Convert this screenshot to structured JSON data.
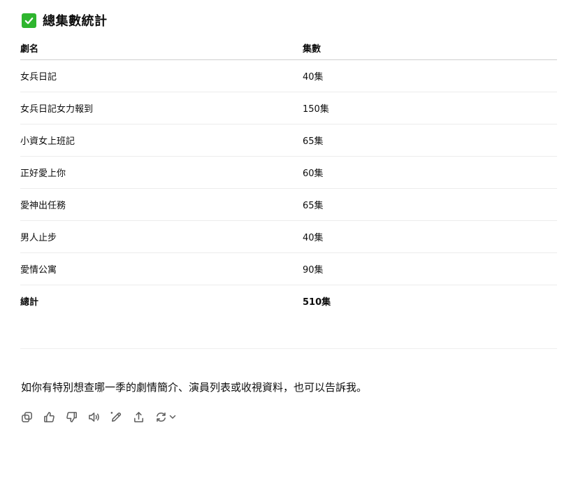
{
  "heading": {
    "title": "總集數統計",
    "icon": "check-mark-button-icon",
    "icon_color": "#2eb52e"
  },
  "table": {
    "headers": [
      "劇名",
      "集數"
    ],
    "rows": [
      {
        "name": "女兵日記",
        "episodes": "40集"
      },
      {
        "name": "女兵日記女力報到",
        "episodes": "150集"
      },
      {
        "name": "小資女上班記",
        "episodes": "65集"
      },
      {
        "name": "正好愛上你",
        "episodes": "60集"
      },
      {
        "name": "愛神出任務",
        "episodes": "65集"
      },
      {
        "name": "男人止步",
        "episodes": "40集"
      },
      {
        "name": "愛情公寓",
        "episodes": "90集"
      }
    ],
    "total": {
      "name": "總計",
      "episodes": "510集"
    }
  },
  "note": "如你有特別想查哪一季的劇情簡介、演員列表或收視資料，也可以告訴我。",
  "actions": [
    {
      "name": "copy-icon"
    },
    {
      "name": "thumbs-up-icon"
    },
    {
      "name": "thumbs-down-icon"
    },
    {
      "name": "read-aloud-icon"
    },
    {
      "name": "edit-icon"
    },
    {
      "name": "share-icon"
    },
    {
      "name": "regenerate-icon"
    }
  ]
}
